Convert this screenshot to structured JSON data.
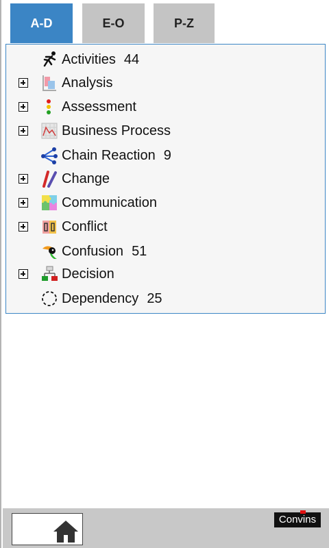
{
  "tabs": [
    {
      "label": "A-D",
      "active": true
    },
    {
      "label": "E-O",
      "active": false
    },
    {
      "label": "P-Z",
      "active": false
    }
  ],
  "items": [
    {
      "label": "Activities",
      "count": "44",
      "expandable": false,
      "icon": "runner-icon"
    },
    {
      "label": "Analysis",
      "count": "",
      "expandable": true,
      "icon": "analysis-chart-icon"
    },
    {
      "label": "Assessment",
      "count": "",
      "expandable": true,
      "icon": "traffic-light-icon"
    },
    {
      "label": "Business Process",
      "count": "",
      "expandable": true,
      "icon": "process-graph-icon"
    },
    {
      "label": "Chain Reaction",
      "count": "9",
      "expandable": false,
      "icon": "network-icon"
    },
    {
      "label": "Change",
      "count": "",
      "expandable": true,
      "icon": "markers-icon"
    },
    {
      "label": "Communication",
      "count": "",
      "expandable": true,
      "icon": "puzzle-icon"
    },
    {
      "label": "Conflict",
      "count": "",
      "expandable": true,
      "icon": "conflict-icon"
    },
    {
      "label": "Confusion",
      "count": "51",
      "expandable": false,
      "icon": "toucan-icon"
    },
    {
      "label": "Decision",
      "count": "",
      "expandable": true,
      "icon": "org-tree-icon"
    },
    {
      "label": "Dependency",
      "count": "25",
      "expandable": false,
      "icon": "dashed-circle-icon"
    }
  ],
  "footer": {
    "home_icon": "home-icon",
    "logo_text": "Convins"
  },
  "colors": {
    "accent": "#3b85c5",
    "tab_inactive": "#c4c4c4",
    "footer_bg": "#c8c8c8"
  }
}
